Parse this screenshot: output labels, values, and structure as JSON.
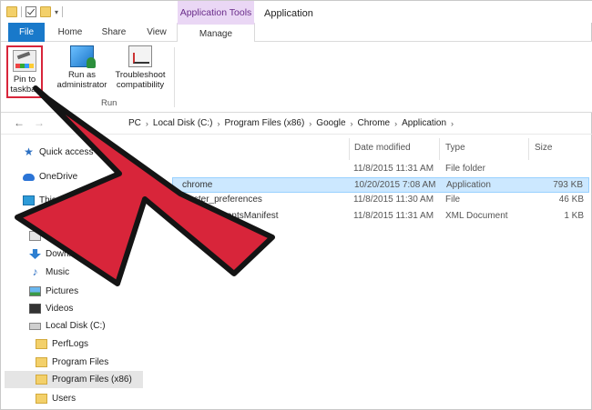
{
  "window": {
    "context_tab_header": "Application Tools",
    "title": "Application"
  },
  "tabs": [
    "File",
    "Home",
    "Share",
    "View",
    "Manage"
  ],
  "ribbon": {
    "buttons": [
      {
        "label": "Pin to taskbar",
        "icon": "pin-taskbar-icon"
      },
      {
        "label": "Run as administrator",
        "icon": "run-as-admin-icon"
      },
      {
        "label": "Troubleshoot compatibility",
        "icon": "troubleshoot-icon"
      }
    ],
    "group_label": "Run"
  },
  "address": {
    "crumbs": [
      "PC",
      "Local Disk (C:)",
      "Program Files (x86)",
      "Google",
      "Chrome",
      "Application"
    ]
  },
  "sidebar": {
    "items": [
      {
        "label": "Quick access",
        "icon": "star-icon"
      },
      {
        "label": "OneDrive",
        "icon": "cloud-icon"
      },
      {
        "label": "This PC",
        "icon": "computer-icon"
      },
      {
        "label": "Desktop",
        "icon": "desktop-icon"
      },
      {
        "label": "Documents",
        "icon": "documents-icon"
      },
      {
        "label": "Downloads",
        "icon": "downloads-icon"
      },
      {
        "label": "Music",
        "icon": "music-icon"
      },
      {
        "label": "Pictures",
        "icon": "pictures-icon"
      },
      {
        "label": "Videos",
        "icon": "videos-icon"
      },
      {
        "label": "Local Disk (C:)",
        "icon": "disk-icon"
      },
      {
        "label": "PerfLogs",
        "icon": "folder-icon"
      },
      {
        "label": "Program Files",
        "icon": "folder-icon"
      },
      {
        "label": "Program Files (x86)",
        "icon": "folder-icon"
      },
      {
        "label": "Users",
        "icon": "folder-icon"
      }
    ]
  },
  "columns": {
    "date": "Date modified",
    "type": "Type",
    "size": "Size"
  },
  "files": [
    {
      "name": "",
      "date": "11/8/2015 11:31 AM",
      "type": "File folder",
      "size": ""
    },
    {
      "name": "chrome",
      "date": "10/20/2015 7:08 AM",
      "type": "Application",
      "size": "793 KB"
    },
    {
      "name": "master_preferences",
      "date": "11/8/2015 11:30 AM",
      "type": "File",
      "size": "46 KB"
    },
    {
      "name": "VisualElementsManifest",
      "date": "11/8/2015 11:31 AM",
      "type": "XML Document",
      "size": "1 KB"
    }
  ],
  "colors": {
    "file_tab": "#1979ca",
    "context_tab": "#ead7f5",
    "selection": "#cce8ff",
    "highlight_border": "#d8253a",
    "arrow_fill": "#d8253a"
  }
}
